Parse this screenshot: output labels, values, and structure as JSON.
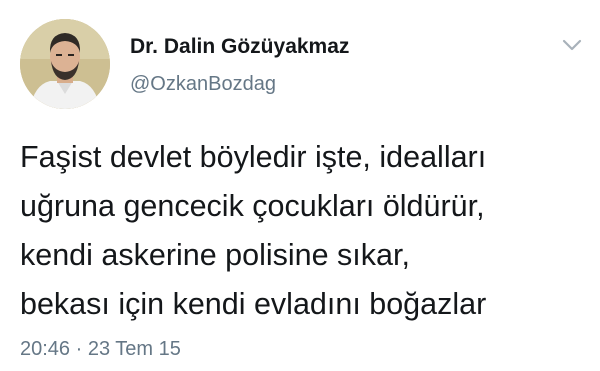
{
  "author": {
    "display_name": "Dr. Dalin Gözüyakmaz",
    "handle": "@OzkanBozdag",
    "avatar_icon": "profile-photo"
  },
  "menu": {
    "icon": "chevron-down-icon"
  },
  "tweet": {
    "text": "Faşist devlet böyledir işte, idealları\nuğruna gencecik çocukları öldürür,\nkendi askerine polisine sıkar,\nbekası için kendi evladını boğazlar",
    "timestamp": "20:46 · 23 Tem 15"
  },
  "colors": {
    "name": "#14171a",
    "secondary": "#657786",
    "chevron": "#a8b2ba"
  }
}
